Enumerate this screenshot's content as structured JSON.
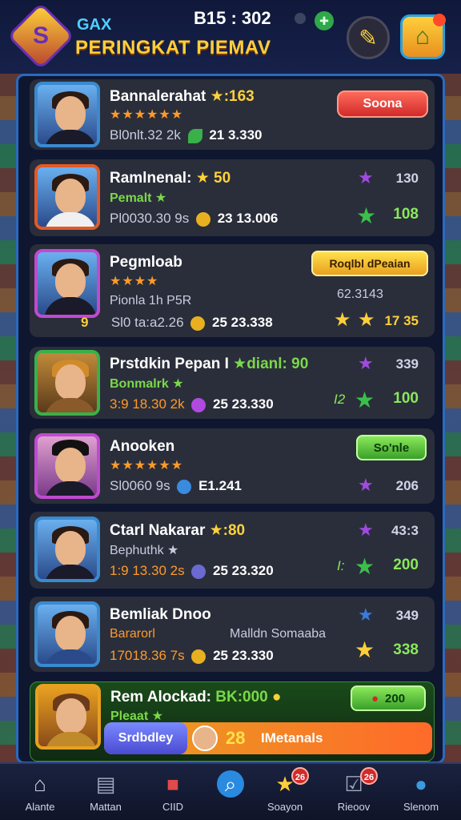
{
  "header": {
    "app_short": "GAX",
    "title": "PERINGKAT PIEMAV",
    "clock": "B15 : 302"
  },
  "rows": [
    {
      "name": "Bannalerahat",
      "points": "★:163",
      "stars": "★★★★★★",
      "stat_left": "Bl0nlt.32 2k",
      "stat_right": "21 3.330",
      "button": "Soona"
    },
    {
      "name": "Ramlnenal:",
      "points": "★ 50",
      "sub": "Pemalt ★",
      "stat_left": "Pl0030.30 9s",
      "stat_right": "23 13.006",
      "top_val": "130",
      "bottom_val": "108"
    },
    {
      "name": "Pegmloab",
      "stars": "★★★★",
      "sub": "Pionla 1h P5R",
      "stat_left": "Sl0 ta:a2.26",
      "stat_right": "25 23.338",
      "badge": "9",
      "button": "Roqlbl dPeaian",
      "mid_val": "62.3143",
      "right_val": "17 35"
    },
    {
      "name": "Prstdkin Pepan I",
      "points": "★dianl: 90",
      "sub": "Bonmalrk ★",
      "stat_left": "3:9 18.30 2k",
      "stat_right": "25 23.330",
      "top_val": "339",
      "bottom_val": "100",
      "side_label": "I2"
    },
    {
      "name": "Anooken",
      "stars": "★★★★★★",
      "stat_left": "Sl0060 9s",
      "stat_right": "E1.241",
      "button": "So'nle",
      "bottom_val": "206"
    },
    {
      "name": "Ctarl Nakarar",
      "points": "★:80",
      "sub": "Bephuthk ★",
      "stat_left": "1:9 13.30 2s",
      "stat_right": "25 23.320",
      "top_val": "43:3",
      "bottom_val": "200",
      "side_label": "I:"
    },
    {
      "name": "Bemliak Dnoo",
      "sub": "Bararorl",
      "extra": "Malldn Somaaba",
      "stat_left": "17018.36 7s",
      "stat_right": "25 23.330",
      "top_val": "349",
      "bottom_val": "338"
    },
    {
      "name": "Rem Alockad:",
      "points": "BK:000",
      "sub": "Pleaat ★",
      "button": "200"
    }
  ],
  "my_rank": {
    "tag": "Srdbdley",
    "number": "28",
    "label": "IMetanals"
  },
  "nav": [
    {
      "label": "Alante"
    },
    {
      "label": "Mattan"
    },
    {
      "label": "CIID"
    },
    {
      "label": ""
    },
    {
      "label": "Soayon",
      "badge": "26"
    },
    {
      "label": "Rieoov",
      "badge": "26"
    },
    {
      "label": "Slenom"
    }
  ]
}
